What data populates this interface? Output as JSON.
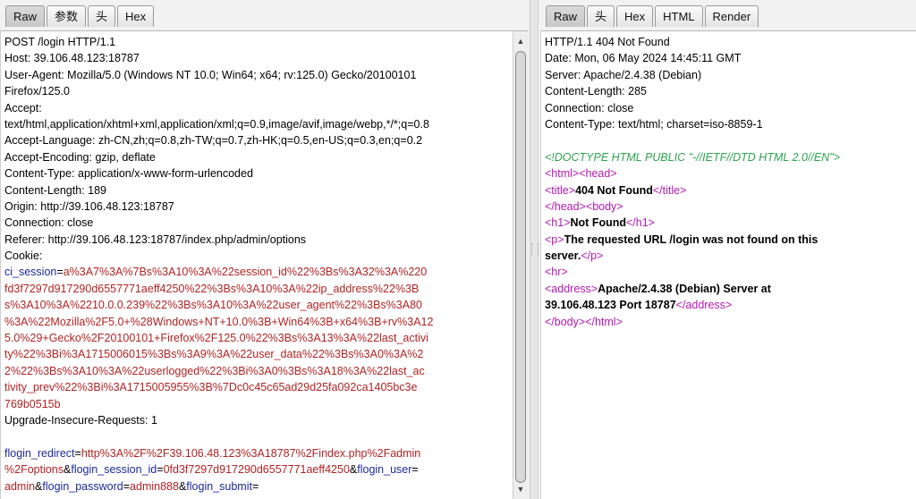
{
  "request_tabs": [
    "Raw",
    "参数",
    "头",
    "Hex"
  ],
  "response_tabs": [
    "Raw",
    "头",
    "Hex",
    "HTML",
    "Render"
  ],
  "request": {
    "lines": [
      "POST /login HTTP/1.1",
      "Host: 39.106.48.123:18787",
      "User-Agent: Mozilla/5.0 (Windows NT 10.0; Win64; x64; rv:125.0) Gecko/20100101",
      "Firefox/125.0",
      "Accept:",
      "text/html,application/xhtml+xml,application/xml;q=0.9,image/avif,image/webp,*/*;q=0.8",
      "Accept-Language: zh-CN,zh;q=0.8,zh-TW;q=0.7,zh-HK;q=0.5,en-US;q=0.3,en;q=0.2",
      "Accept-Encoding: gzip, deflate",
      "Content-Type: application/x-www-form-urlencoded",
      "Content-Length: 189",
      "Origin: http://39.106.48.123:18787",
      "Connection: close",
      "Referer: http://39.106.48.123:18787/index.php/admin/options",
      "Cookie:"
    ],
    "cookie_name": "ci_session",
    "cookie_lines": [
      "a%3A7%3A%7Bs%3A10%3A%22session_id%22%3Bs%3A32%3A%220",
      "fd3f7297d917290d6557771aeff4250%22%3Bs%3A10%3A%22ip_address%22%3B",
      "s%3A10%3A%2210.0.0.239%22%3Bs%3A10%3A%22user_agent%22%3Bs%3A80",
      "%3A%22Mozilla%2F5.0+%28Windows+NT+10.0%3B+Win64%3B+x64%3B+rv%3A12",
      "5.0%29+Gecko%2F20100101+Firefox%2F125.0%22%3Bs%3A13%3A%22last_activi",
      "ty%22%3Bi%3A1715006015%3Bs%3A9%3A%22user_data%22%3Bs%3A0%3A%2",
      "2%22%3Bs%3A10%3A%22userlogged%22%3Bi%3A0%3Bs%3A18%3A%22last_ac",
      "tivity_prev%22%3Bi%3A1715005955%3B%7Dc0c45c65ad29d25fa092ca1405bc3e",
      "769b0515b"
    ],
    "upgrade_line": "Upgrade-Insecure-Requests: 1",
    "body": {
      "p1_key": "flogin_redirect",
      "p1_val_a": "http%3A%2F%2F39.106.48.123%3A18787%2Findex.php%2Fadmin",
      "p1_val_b": "%2Foptions",
      "p2_key": "flogin_session_id",
      "p2_val": "0fd3f7297d917290d6557771aeff4250",
      "p3_key": "flogin_user",
      "p3_val": "admin",
      "p4_key": "flogin_password",
      "p4_val": "admin888",
      "p5_key": "flogin_submit",
      "amp": "&",
      "eq": "="
    }
  },
  "response": {
    "headers": [
      "HTTP/1.1 404 Not Found",
      "Date: Mon, 06 May 2024 14:45:11 GMT",
      "Server: Apache/2.4.38 (Debian)",
      "Content-Length: 285",
      "Connection: close",
      "Content-Type: text/html; charset=iso-8859-1"
    ],
    "doctype": "<!DOCTYPE HTML PUBLIC \"-//IETF//DTD HTML 2.0//EN\">",
    "t_html": "<html>",
    "t_head": "<head>",
    "t_title": "<title>",
    "title_text": "404 Not Found",
    "t_title_end": "</title>",
    "t_head_end": "</head>",
    "t_body": "<body>",
    "t_h1": "<h1>",
    "h1_text": "Not Found",
    "t_h1_end": "</h1>",
    "t_p": "<p>",
    "p_text_a": "The requested URL /login was not found on this",
    "p_text_b": "server.",
    "t_p_end": "</p>",
    "t_hr": "<hr>",
    "t_address": "<address>",
    "address_text_a": "Apache/2.4.38 (Debian) Server at",
    "address_text_b": "39.106.48.123 Port 18787",
    "t_address_end": "</address>",
    "t_body_end": "</body>",
    "t_html_end": "</html>"
  }
}
